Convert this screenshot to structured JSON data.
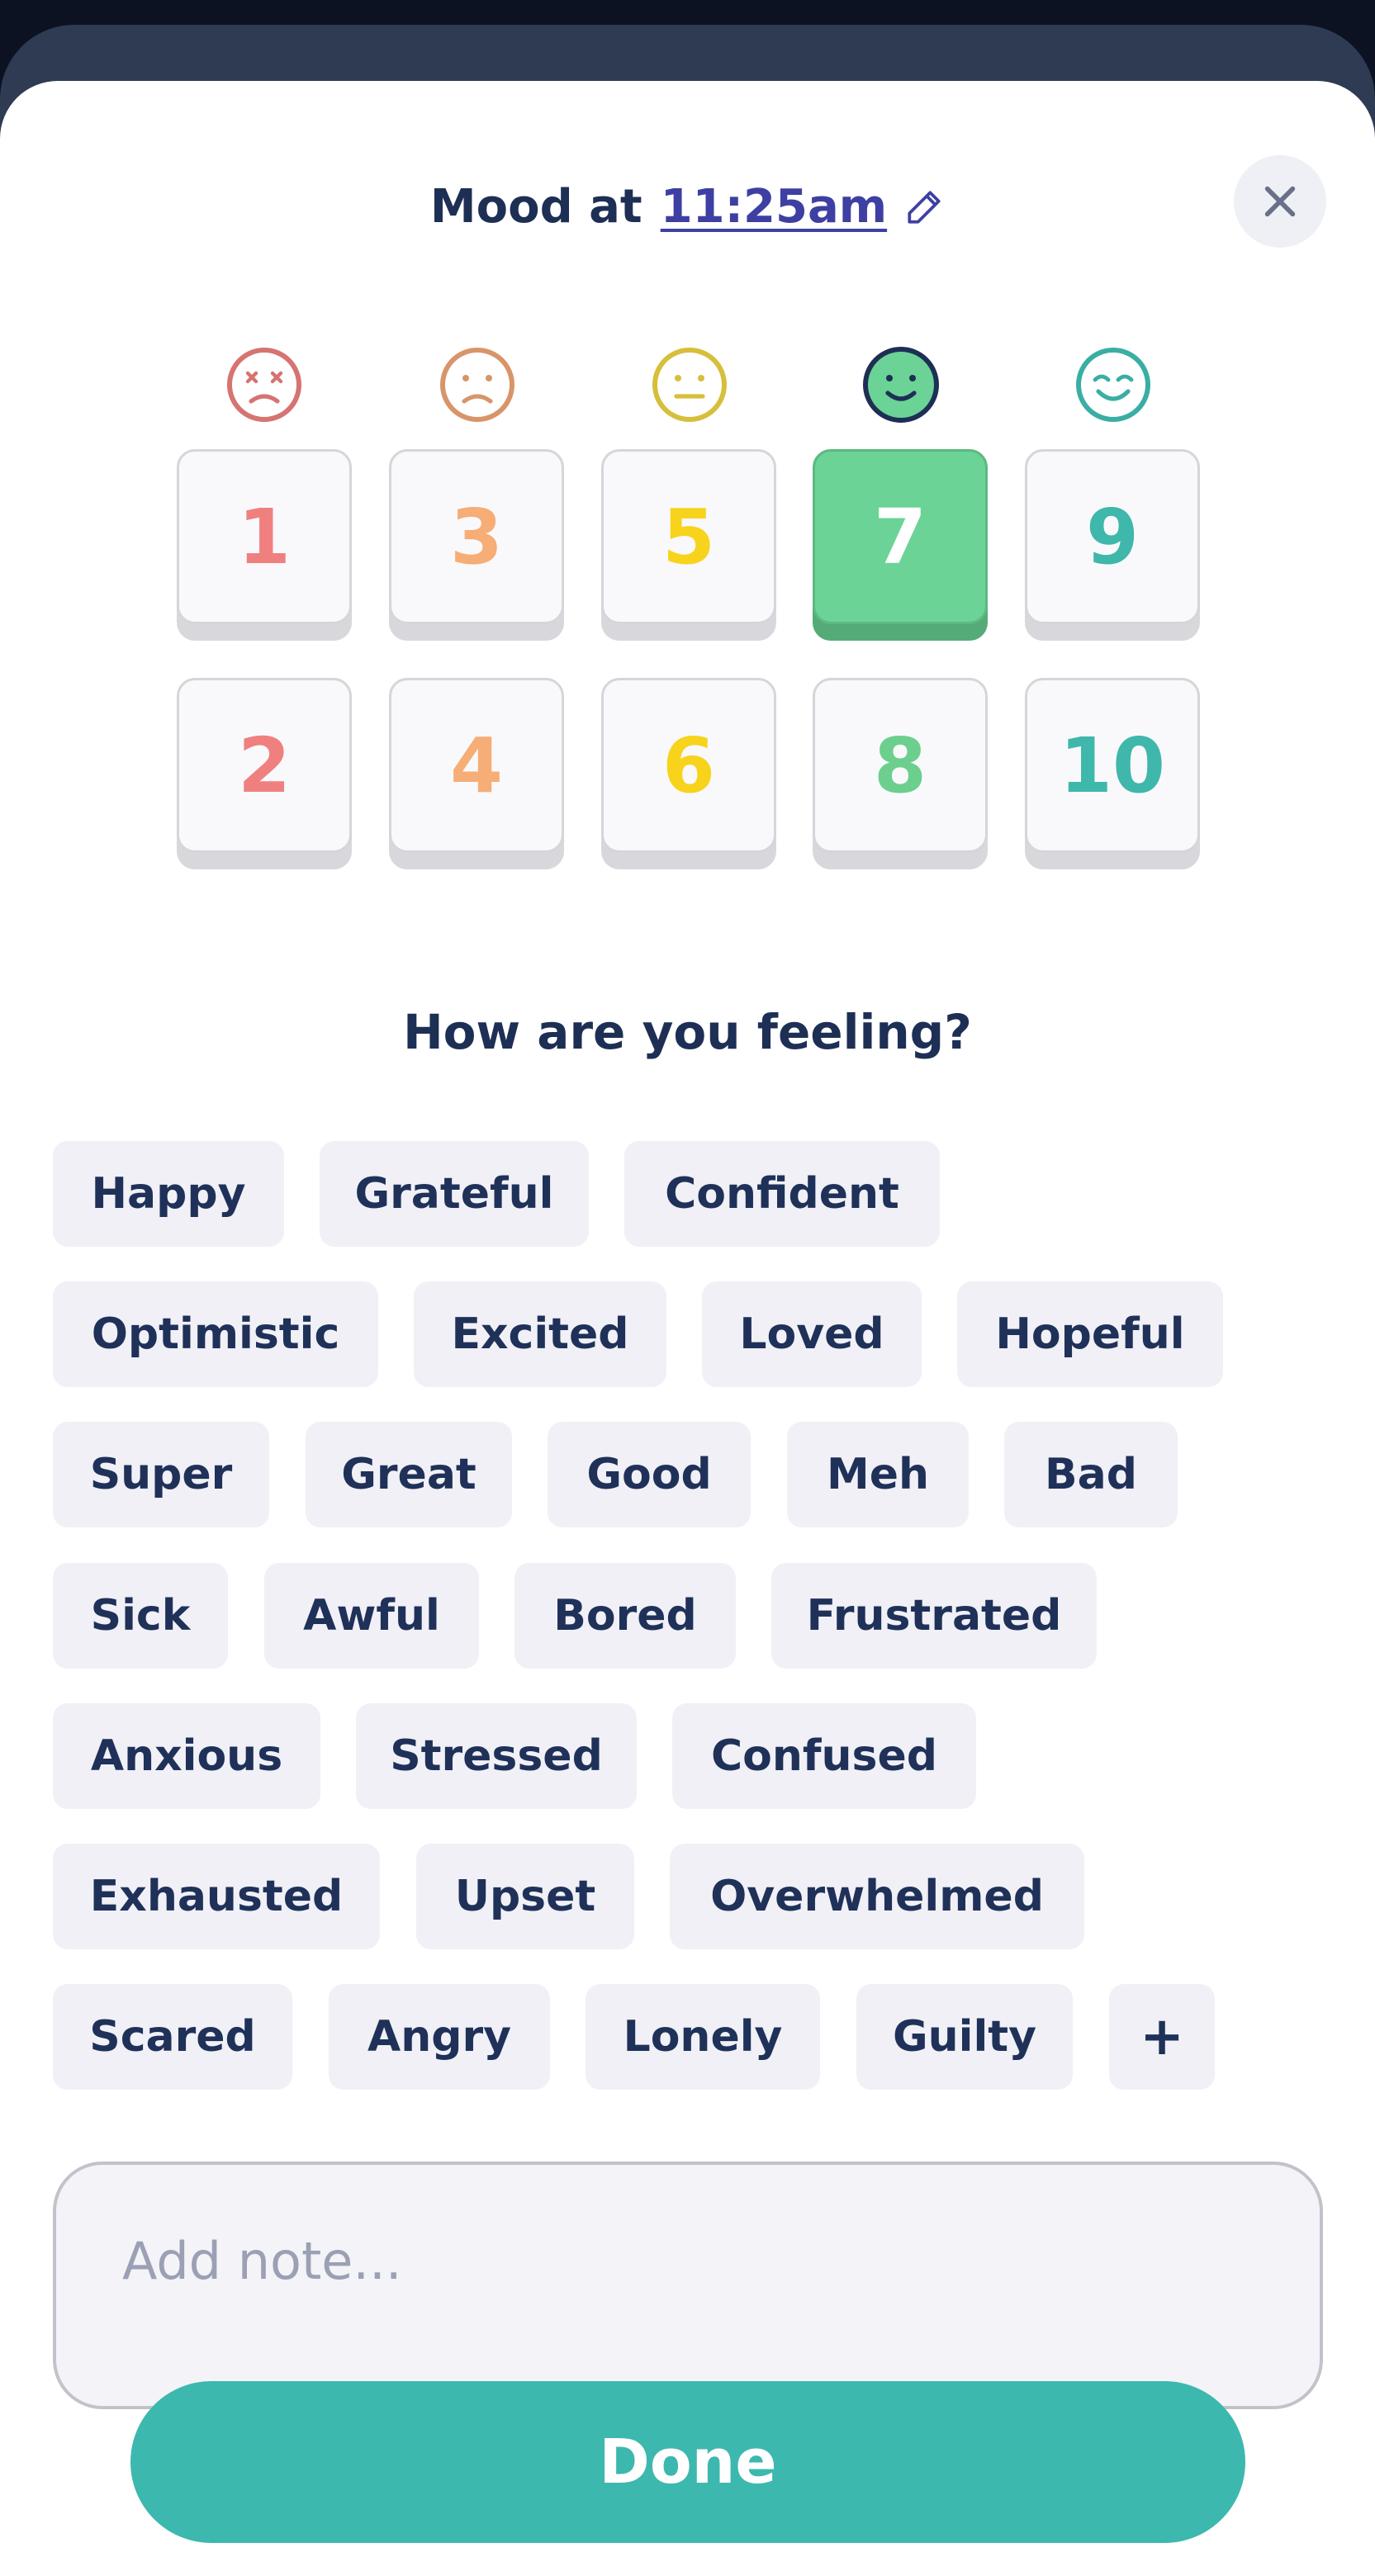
{
  "header": {
    "title_prefix": "Mood at",
    "time": "11:25am"
  },
  "mood_scale": {
    "selected": "7",
    "faces": [
      {
        "icon": "face-dead-icon",
        "color": "#d57471"
      },
      {
        "icon": "face-sad-icon",
        "color": "#d8956a"
      },
      {
        "icon": "face-neutral-icon",
        "color": "#d6bf3a"
      },
      {
        "icon": "face-smile-icon",
        "color": "#1e2f55"
      },
      {
        "icon": "face-happy-icon",
        "color": "#3aaea4"
      }
    ],
    "scores": [
      {
        "label": "1",
        "color": "#f08080"
      },
      {
        "label": "3",
        "color": "#f6ad76"
      },
      {
        "label": "5",
        "color": "#f8d31c"
      },
      {
        "label": "7",
        "color": "#ffffff"
      },
      {
        "label": "9",
        "color": "#3fb7ab"
      },
      {
        "label": "2",
        "color": "#f08080"
      },
      {
        "label": "4",
        "color": "#f6ad76"
      },
      {
        "label": "6",
        "color": "#f8d31c"
      },
      {
        "label": "8",
        "color": "#6ccf8e"
      },
      {
        "label": "10",
        "color": "#3fb7ab"
      }
    ]
  },
  "feelings": {
    "question": "How are you feeling?",
    "chips": [
      "Happy",
      "Grateful",
      "Confident",
      "Optimistic",
      "Excited",
      "Loved",
      "Hopeful",
      "Super",
      "Great",
      "Good",
      "Meh",
      "Bad",
      "Sick",
      "Awful",
      "Bored",
      "Frustrated",
      "Anxious",
      "Stressed",
      "Confused",
      "Exhausted",
      "Upset",
      "Overwhelmed",
      "Scared",
      "Angry",
      "Lonely",
      "Guilty"
    ],
    "add_label": "+"
  },
  "note": {
    "placeholder": "Add note..."
  },
  "done_label": "Done",
  "colors": {
    "accent": "#3db8ae",
    "selected": "#6bd395",
    "text_dark": "#1e2f55",
    "link": "#3e3fa2"
  }
}
